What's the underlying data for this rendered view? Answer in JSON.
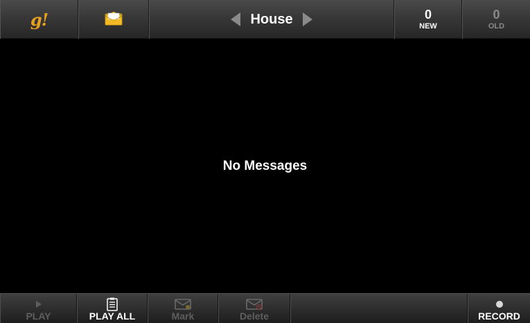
{
  "header": {
    "logo_text": "g!",
    "mailbox_name": "House",
    "new_count": "0",
    "new_label": "NEW",
    "old_count": "0",
    "old_label": "OLD"
  },
  "main": {
    "empty_message": "No Messages"
  },
  "toolbar": {
    "play_label": "PLAY",
    "play_all_label": "PLAY ALL",
    "mark_label": "Mark",
    "delete_label": "Delete",
    "record_label": "RECORD"
  },
  "icons": {
    "logo": "g-logo-icon",
    "mail": "envelope-icon",
    "prev": "chevron-left-icon",
    "next": "chevron-right-icon",
    "play": "play-icon",
    "play_all": "list-icon",
    "mark": "envelope-mark-icon",
    "delete": "envelope-delete-icon",
    "record": "record-dot-icon"
  },
  "colors": {
    "logo": "#e8a020",
    "envelope": "#f0c020",
    "disabled_text": "#5e5e5e",
    "enabled_text": "#ffffff"
  }
}
